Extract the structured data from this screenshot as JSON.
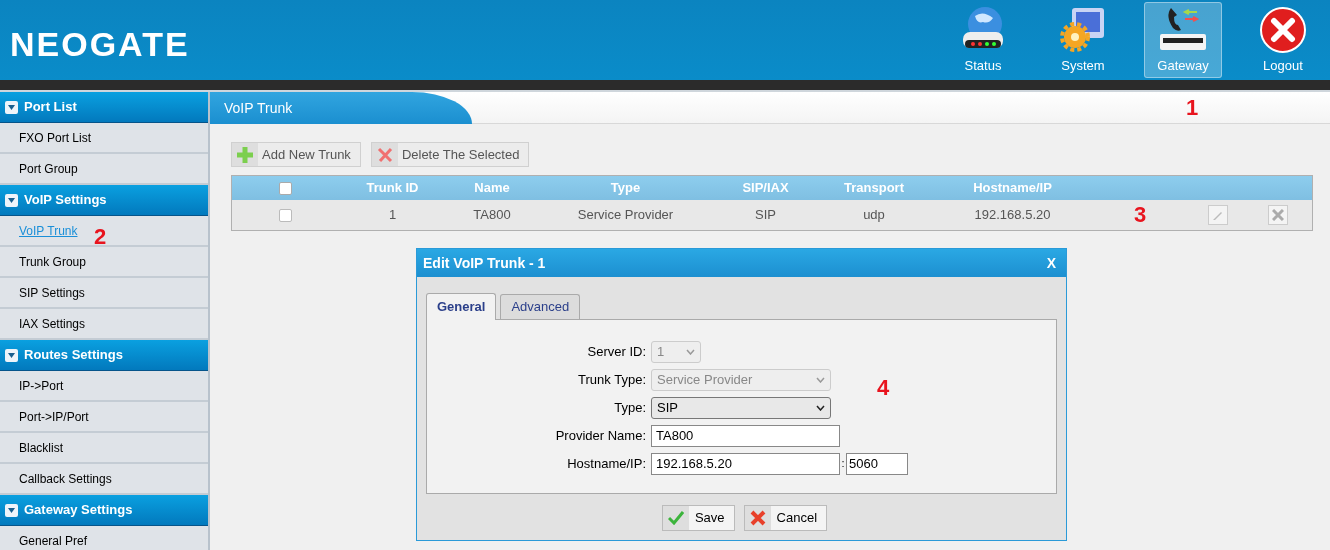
{
  "header": {
    "logo": "NEOGATE",
    "nav": [
      {
        "label": "Status",
        "kind": "status",
        "selected": false
      },
      {
        "label": "System",
        "kind": "system",
        "selected": false
      },
      {
        "label": "Gateway",
        "kind": "gateway",
        "selected": true
      },
      {
        "label": "Logout",
        "kind": "logout",
        "selected": false
      }
    ]
  },
  "sidebar": {
    "sections": [
      {
        "title": "Port List",
        "items": [
          {
            "label": "FXO Port List",
            "selected": false
          },
          {
            "label": "Port Group",
            "selected": false
          }
        ]
      },
      {
        "title": "VoIP Settings",
        "items": [
          {
            "label": "VoIP Trunk",
            "selected": true
          },
          {
            "label": "Trunk Group",
            "selected": false
          },
          {
            "label": "SIP Settings",
            "selected": false
          },
          {
            "label": "IAX Settings",
            "selected": false
          }
        ]
      },
      {
        "title": "Routes Settings",
        "items": [
          {
            "label": "IP->Port",
            "selected": false
          },
          {
            "label": "Port->IP/Port",
            "selected": false
          },
          {
            "label": "Blacklist",
            "selected": false
          },
          {
            "label": "Callback Settings",
            "selected": false
          }
        ]
      },
      {
        "title": "Gateway Settings",
        "items": [
          {
            "label": "General Pref",
            "selected": false
          }
        ]
      }
    ]
  },
  "page": {
    "title": "VoIP Trunk",
    "toolbar": [
      {
        "label": "Add New Trunk",
        "kind": "add"
      },
      {
        "label": "Delete The Selected",
        "kind": "delete"
      }
    ],
    "table": {
      "columns": [
        "Trunk ID",
        "Name",
        "Type",
        "SIP/IAX",
        "Transport",
        "Hostname/IP"
      ],
      "all_checked": false,
      "rows": [
        {
          "checked": false,
          "cells": [
            "1",
            "TA800",
            "Service Provider",
            "SIP",
            "udp",
            "192.168.5.20"
          ]
        }
      ]
    }
  },
  "dialog": {
    "title": "Edit VoIP Trunk - 1",
    "close": "X",
    "tabs": [
      {
        "label": "General",
        "selected": true
      },
      {
        "label": "Advanced",
        "selected": false
      }
    ],
    "fields": [
      {
        "kind": "select",
        "label": "Server ID:",
        "value": "1",
        "disabled": true
      },
      {
        "kind": "select",
        "label": "Trunk Type:",
        "value": "Service Provider",
        "disabled": true
      },
      {
        "kind": "select",
        "label": "Type:",
        "value": "SIP",
        "disabled": false
      },
      {
        "kind": "input",
        "label": "Provider Name:",
        "value": "TA800"
      },
      {
        "kind": "host",
        "label": "Hostname/IP:",
        "value": "192.168.5.20",
        "separator": ":",
        "port": "5060"
      }
    ],
    "buttons": [
      {
        "label": "Save",
        "kind": "save"
      },
      {
        "label": "Cancel",
        "kind": "cancel"
      }
    ]
  },
  "annotations": [
    "1",
    "2",
    "3",
    "4"
  ]
}
